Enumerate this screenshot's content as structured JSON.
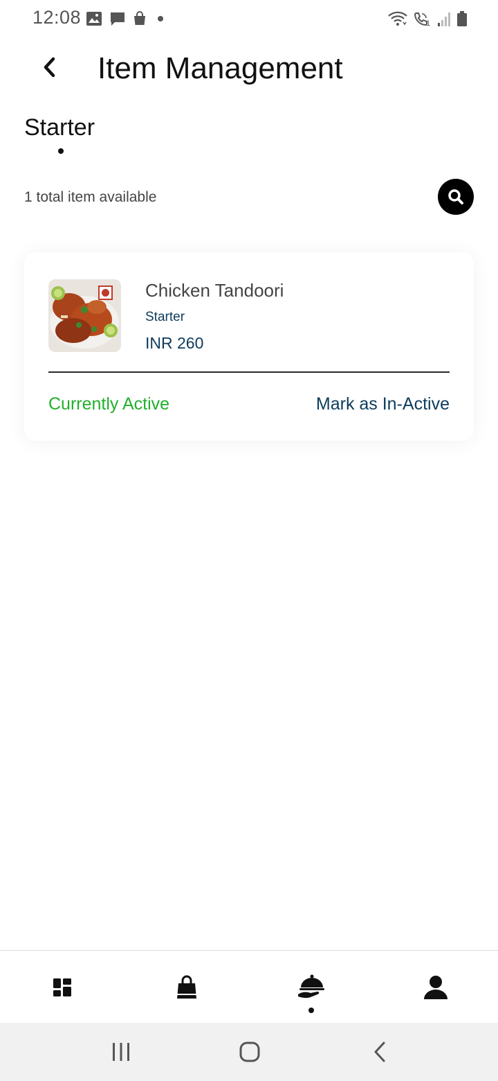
{
  "status_bar": {
    "time": "12:08",
    "icons_left": [
      "image-icon",
      "message-icon",
      "shopping-bag-icon",
      "dot-icon"
    ],
    "icons_right": [
      "wifi-icon",
      "wifi-call-icon",
      "signal-icon",
      "battery-icon"
    ],
    "wifi_call_sim": "1"
  },
  "header": {
    "title": "Item Management",
    "back_icon": "chevron-left-icon"
  },
  "category_tab": {
    "label": "Starter"
  },
  "summary": {
    "total_text": "1 total item available",
    "search_icon": "search-icon"
  },
  "items": [
    {
      "name": "Chicken Tandoori",
      "category": "Starter",
      "price": "INR 260",
      "status": "Currently Active",
      "action": "Mark as In-Active",
      "food_type_mark": "non-veg-mark-icon"
    }
  ],
  "bottom_nav": {
    "items": [
      "dashboard-icon",
      "orders-bag-icon",
      "menu-cloche-icon",
      "profile-icon"
    ],
    "active_index": 2
  },
  "system_nav": [
    "recents-icon",
    "home-icon",
    "back-icon"
  ],
  "colors": {
    "active_status": "#22b02c",
    "action_link": "#0d3b5c",
    "non_veg_mark": "#c0392b",
    "search_button": "#000000",
    "system_nav_bg": "#f1f1f1"
  }
}
